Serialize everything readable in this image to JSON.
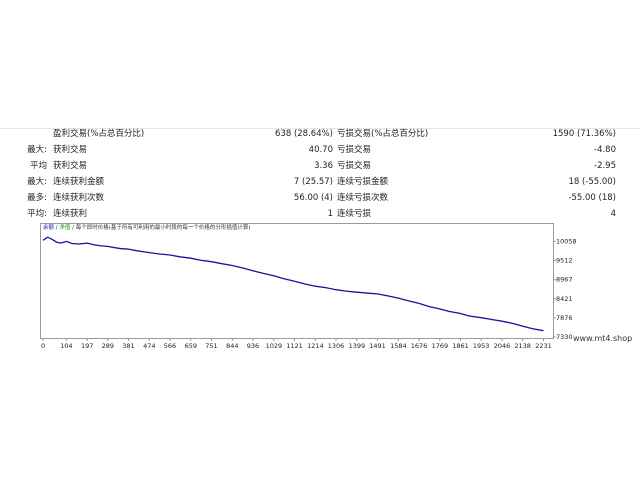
{
  "stats": {
    "rows": [
      {
        "prefix": "",
        "label1": "盈利交易(%占总百分比)",
        "value1": "638 (28.64%)",
        "label2": "亏损交易(%占总百分比)",
        "value2": "1590 (71.36%)"
      },
      {
        "prefix": "最大:",
        "label1": "获利交易",
        "value1": "40.70",
        "label2": "亏损交易",
        "value2": "-4.80"
      },
      {
        "prefix": "平均",
        "label1": "获利交易",
        "value1": "3.36",
        "label2": "亏损交易",
        "value2": "-2.95"
      },
      {
        "prefix": "最大:",
        "label1": "连续获利金额",
        "value1": "7 (25.57)",
        "label2": "连续亏损金额",
        "value2": "18 (-55.00)"
      },
      {
        "prefix": "最多:",
        "label1": "连续获利次数",
        "value1": "56.00 (4)",
        "label2": "连续亏损次数",
        "value2": "-55.00 (18)"
      },
      {
        "prefix": "平均:",
        "label1": "连续获利",
        "value1": "1",
        "label2": "连续亏损",
        "value2": "4"
      }
    ]
  },
  "legend": {
    "balance": "余额",
    "sep": " / ",
    "equity": "净值",
    "description": " / 每个即时价格(基于所有可利用的最小时段的每一个价格的分形插值计算)"
  },
  "watermark": "www.mt4.shop",
  "colors": {
    "line": "#1414a0",
    "equity": "#2e8b2e"
  },
  "chart_data": {
    "type": "line",
    "title": "",
    "xlabel": "",
    "ylabel": "",
    "x_ticks": [
      0,
      104,
      197,
      289,
      381,
      474,
      566,
      659,
      751,
      844,
      936,
      1029,
      1121,
      1214,
      1306,
      1399,
      1491,
      1584,
      1676,
      1769,
      1861,
      1953,
      2046,
      2138,
      2231
    ],
    "y_ticks": [
      7330,
      7876,
      8421,
      8967,
      9512,
      10058
    ],
    "xlim": [
      0,
      2260
    ],
    "ylim": [
      7330,
      10270
    ],
    "grid": false,
    "series": [
      {
        "x": [
          0,
          20,
          40,
          60,
          80,
          104,
          130,
          160,
          197,
          230,
          260,
          289,
          320,
          350,
          381,
          420,
          474,
          520,
          566,
          610,
          659,
          700,
          751,
          800,
          844,
          890,
          936,
          980,
          1029,
          1070,
          1121,
          1170,
          1214,
          1260,
          1306,
          1350,
          1399,
          1450,
          1491,
          1540,
          1584,
          1630,
          1676,
          1720,
          1769,
          1810,
          1861,
          1900,
          1953,
          2000,
          2046,
          2090,
          2138,
          2180,
          2231
        ],
        "y": [
          10090,
          10180,
          10120,
          10040,
          10010,
          10060,
          10000,
          9985,
          10010,
          9960,
          9930,
          9915,
          9880,
          9850,
          9840,
          9790,
          9740,
          9700,
          9670,
          9620,
          9580,
          9525,
          9480,
          9420,
          9370,
          9300,
          9220,
          9150,
          9080,
          9000,
          8920,
          8840,
          8780,
          8740,
          8680,
          8640,
          8610,
          8580,
          8560,
          8500,
          8440,
          8360,
          8290,
          8200,
          8130,
          8060,
          8000,
          7930,
          7880,
          7830,
          7780,
          7720,
          7640,
          7570,
          7510
        ]
      }
    ]
  }
}
